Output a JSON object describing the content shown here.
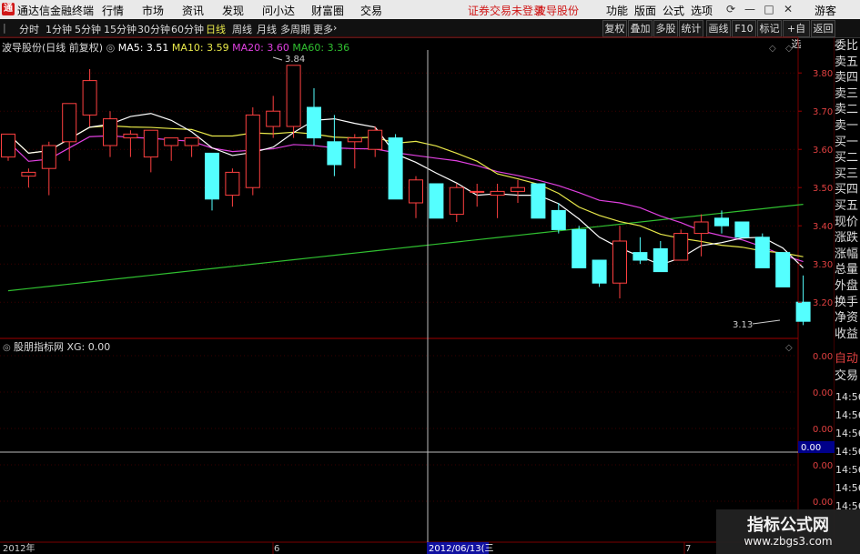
{
  "app": {
    "title": "通达信金融终端"
  },
  "menu": [
    "行情",
    "市场",
    "资讯",
    "发现",
    "问小达",
    "财富圈",
    "交易"
  ],
  "status": {
    "notice": "证券交易未登录",
    "stock": "波导股份"
  },
  "topright": [
    "功能",
    "版面",
    "公式",
    "选项"
  ],
  "user": "游客",
  "toolbar": {
    "periods": [
      "分时",
      "1分钟",
      "5分钟",
      "15分钟",
      "30分钟",
      "60分钟",
      "日线",
      "周线",
      "月线",
      "多周期",
      "更多"
    ],
    "active": "日线",
    "right_buttons": [
      "复权",
      "叠加",
      "多股",
      "统计",
      "画线",
      "F10",
      "标记",
      "+自选",
      "返回"
    ]
  },
  "main": {
    "stock_label": "波导股份(日线 前复权)",
    "ma": [
      {
        "label": "MA5: 3.51",
        "color": "#ffffff"
      },
      {
        "label": "MA10: 3.59",
        "color": "#e8e84a"
      },
      {
        "label": "MA20: 3.60",
        "color": "#e040e0"
      },
      {
        "label": "MA60: 3.36",
        "color": "#30c030"
      }
    ],
    "y_ticks": [
      "3.80",
      "3.70",
      "3.60",
      "3.50",
      "3.40",
      "3.30",
      "3.20"
    ],
    "y_values": [
      3.8,
      3.7,
      3.6,
      3.5,
      3.4,
      3.3,
      3.2
    ],
    "high_label": "3.84",
    "low_label": "3.13"
  },
  "sub": {
    "label": "股朋指标网 XG: 0.00",
    "y_ticks": [
      "0.00",
      "0.00",
      "0.00",
      "0.00",
      "0.00"
    ],
    "current": "0.00"
  },
  "side_labels": [
    "委比",
    "卖五",
    "卖四",
    "卖三",
    "卖二",
    "卖一",
    "买一",
    "买二",
    "买三",
    "买四",
    "买五",
    "现价",
    "涨跌",
    "涨幅",
    "总量",
    "外盘",
    "换手",
    "净资",
    "收益"
  ],
  "side_bottom": [
    "自动",
    "交易"
  ],
  "times": [
    "14:56",
    "14:56",
    "14:56",
    "14:56",
    "14:56",
    "14:56",
    "14:56"
  ],
  "xaxis": {
    "labels": [
      "2012年",
      "6",
      "2012/06/13(三",
      "7"
    ]
  },
  "watermark": {
    "title": "指标公式网",
    "url": "www.zbgs3.com"
  },
  "colors": {
    "up": "#ff4040",
    "down": "#54ffff",
    "grid": "#7a0000"
  },
  "chart_data": {
    "type": "candlestick",
    "ylim": [
      3.13,
      3.84
    ],
    "ohlc": [
      [
        3.58,
        3.64,
        3.57,
        3.64
      ],
      [
        3.53,
        3.55,
        3.5,
        3.54
      ],
      [
        3.55,
        3.62,
        3.48,
        3.61
      ],
      [
        3.62,
        3.71,
        3.57,
        3.72
      ],
      [
        3.69,
        3.81,
        3.66,
        3.78
      ],
      [
        3.61,
        3.7,
        3.58,
        3.68
      ],
      [
        3.63,
        3.65,
        3.58,
        3.64
      ],
      [
        3.58,
        3.65,
        3.54,
        3.65
      ],
      [
        3.61,
        3.63,
        3.57,
        3.63
      ],
      [
        3.61,
        3.62,
        3.58,
        3.63
      ],
      [
        3.59,
        3.48,
        3.44,
        3.47
      ],
      [
        3.48,
        3.55,
        3.45,
        3.54
      ],
      [
        3.5,
        3.71,
        3.48,
        3.69
      ],
      [
        3.66,
        3.74,
        3.63,
        3.7
      ],
      [
        3.66,
        3.8,
        3.63,
        3.82
      ],
      [
        3.71,
        3.76,
        3.61,
        3.63
      ],
      [
        3.62,
        3.69,
        3.53,
        3.56
      ],
      [
        3.62,
        3.64,
        3.55,
        3.63
      ],
      [
        3.6,
        3.66,
        3.58,
        3.65
      ],
      [
        3.63,
        3.64,
        3.47,
        3.47
      ],
      [
        3.46,
        3.53,
        3.42,
        3.52
      ],
      [
        3.51,
        3.51,
        3.42,
        3.42
      ],
      [
        3.43,
        3.51,
        3.41,
        3.5
      ],
      [
        3.49,
        3.51,
        3.45,
        3.49
      ],
      [
        3.48,
        3.51,
        3.42,
        3.49
      ],
      [
        3.49,
        3.52,
        3.46,
        3.5
      ],
      [
        3.51,
        3.51,
        3.42,
        3.42
      ],
      [
        3.44,
        3.46,
        3.38,
        3.39
      ],
      [
        3.39,
        3.4,
        3.29,
        3.29
      ],
      [
        3.31,
        3.3,
        3.24,
        3.25
      ],
      [
        3.25,
        3.4,
        3.21,
        3.36
      ],
      [
        3.33,
        3.37,
        3.3,
        3.31
      ],
      [
        3.34,
        3.36,
        3.28,
        3.28
      ],
      [
        3.31,
        3.39,
        3.31,
        3.38
      ],
      [
        3.38,
        3.43,
        3.32,
        3.41
      ],
      [
        3.42,
        3.44,
        3.38,
        3.4
      ],
      [
        3.41,
        3.41,
        3.37,
        3.37
      ],
      [
        3.37,
        3.38,
        3.29,
        3.29
      ],
      [
        3.33,
        3.33,
        3.24,
        3.24
      ],
      [
        3.2,
        3.27,
        3.14,
        3.15
      ]
    ]
  }
}
